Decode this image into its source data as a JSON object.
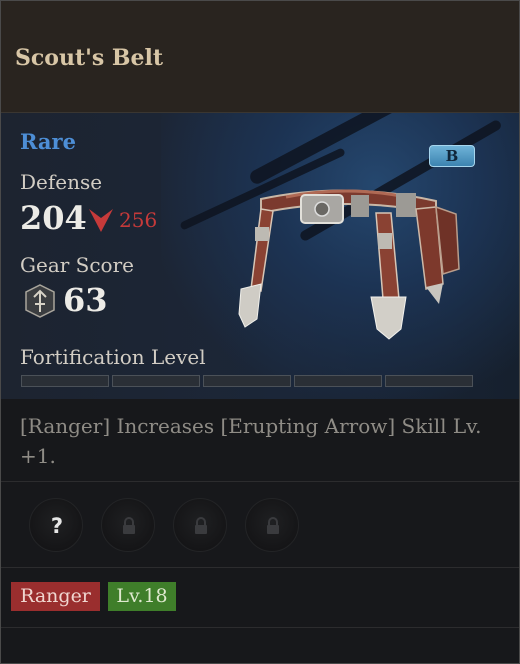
{
  "item": {
    "name": "Scout's Belt",
    "rarity": "Rare",
    "grade": "B",
    "icon": "belt-item-icon"
  },
  "stats": {
    "defense_label": "Defense",
    "defense_value": "204",
    "defense_compare": "256",
    "gear_score_label": "Gear Score",
    "gear_score_value": "63",
    "fortification_label": "Fortification Level",
    "fortification_filled": 0,
    "fortification_total": 5
  },
  "description": "[Ranger] Increases [Erupting Arrow] Skill Lv. +1.",
  "slots": [
    {
      "state": "unknown",
      "glyph": "?"
    },
    {
      "state": "locked",
      "glyph": ""
    },
    {
      "state": "locked",
      "glyph": ""
    },
    {
      "state": "locked",
      "glyph": ""
    }
  ],
  "tags": {
    "class": "Ranger",
    "level": "Lv.18"
  },
  "colors": {
    "rarity": "#4d8ed6",
    "compare_down": "#c63a3a",
    "class_tag": "#9a2e2e",
    "level_tag": "#3f7e2a",
    "grade_badge": "#5aa4cf"
  }
}
